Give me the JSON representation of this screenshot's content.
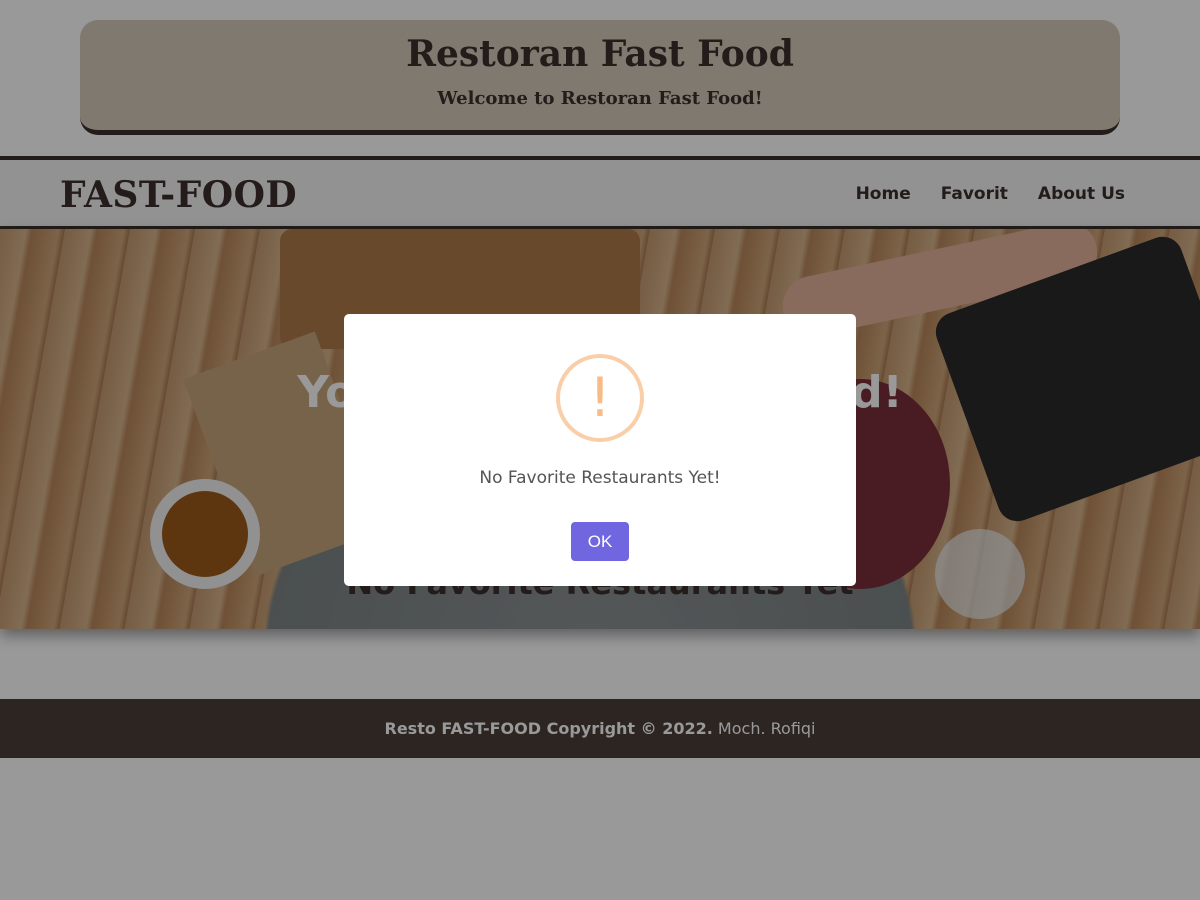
{
  "header": {
    "title": "Restoran Fast Food",
    "subtitle": "Welcome to Restoran Fast Food!"
  },
  "navbar": {
    "brand": "FAST-FOOD",
    "links": [
      "Home",
      "Favorit",
      "About Us"
    ]
  },
  "hero": {
    "title": "Your Favorite Fast Food!",
    "empty_message": "No Favorite Restaurants Yet"
  },
  "footer": {
    "copyright": "Resto FAST-FOOD Copyright © 2022.",
    "author": "Moch. Rofiqi"
  },
  "dialog": {
    "icon": "exclamation-icon",
    "icon_glyph": "!",
    "message": "No Favorite Restaurants Yet!",
    "ok_label": "OK",
    "ok_color": "#7066e0",
    "icon_color": "#f8bb86"
  }
}
